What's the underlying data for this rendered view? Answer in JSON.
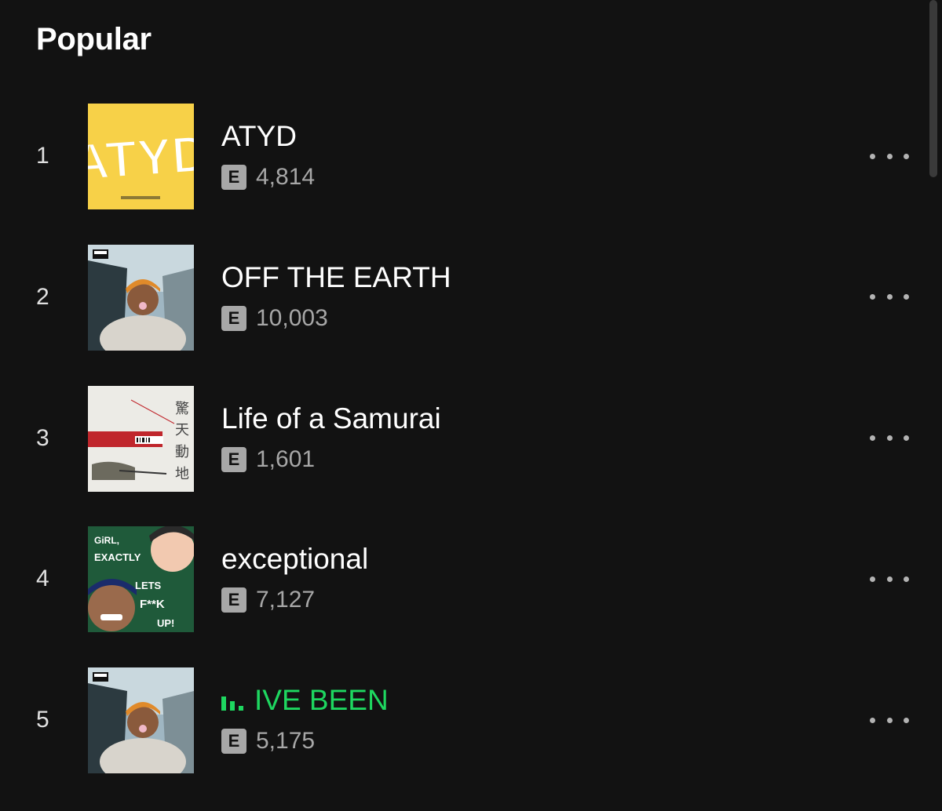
{
  "section": {
    "title": "Popular"
  },
  "explicit_label": "E",
  "tracks": [
    {
      "index": "1",
      "title": "ATYD",
      "plays": "4,814",
      "explicit": true,
      "playing": false,
      "art": "atyd-cover"
    },
    {
      "index": "2",
      "title": "OFF THE EARTH",
      "plays": "10,003",
      "explicit": true,
      "playing": false,
      "art": "portrait-car-cover"
    },
    {
      "index": "3",
      "title": "Life of a Samurai",
      "plays": "1,601",
      "explicit": true,
      "playing": false,
      "art": "samurai-cover"
    },
    {
      "index": "4",
      "title": "exceptional",
      "plays": "7,127",
      "explicit": true,
      "playing": false,
      "art": "exceptional-cover"
    },
    {
      "index": "5",
      "title": "IVE BEEN",
      "plays": "5,175",
      "explicit": true,
      "playing": true,
      "art": "portrait-car-cover"
    }
  ],
  "colors": {
    "background": "#121212",
    "accent_playing": "#1ed760",
    "muted_text": "#a7a7a7",
    "atyd_yellow": "#f7d148"
  },
  "icons": {
    "more": "more-options-icon",
    "playing": "equalizer-icon"
  }
}
